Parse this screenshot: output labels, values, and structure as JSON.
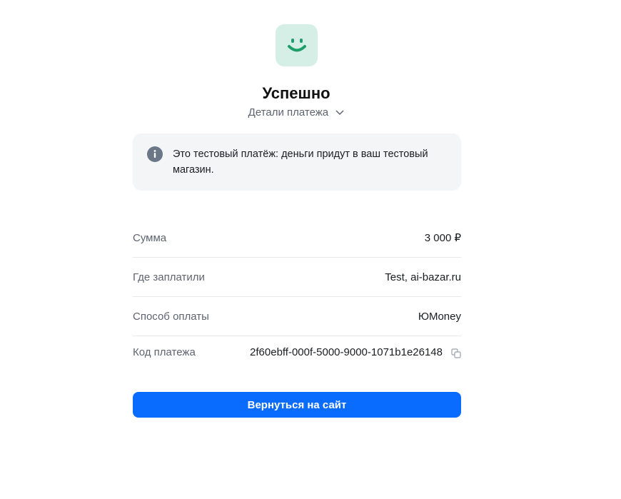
{
  "status": {
    "title": "Успешно",
    "details_toggle": "Детали платежа"
  },
  "notice": {
    "text": "Это тестовый платёж: деньги придут в ваш тестовый магазин."
  },
  "payment": {
    "rows": [
      {
        "label": "Сумма",
        "value": "3 000 ₽"
      },
      {
        "label": "Где заплатили",
        "value": "Test, ai-bazar.ru"
      },
      {
        "label": "Способ оплаты",
        "value": "ЮMoney"
      },
      {
        "label": "Код платежа",
        "value": "2f60ebff-000f-5000-9000-1071b1e26148"
      }
    ]
  },
  "actions": {
    "return_label": "Вернуться на сайт"
  },
  "colors": {
    "accent": "#0a6cff",
    "success_bg": "#d6efe6",
    "success_icon": "#1e9e6a"
  },
  "icons": [
    "smile-icon",
    "chevron-down-icon",
    "info-icon",
    "copy-icon"
  ]
}
